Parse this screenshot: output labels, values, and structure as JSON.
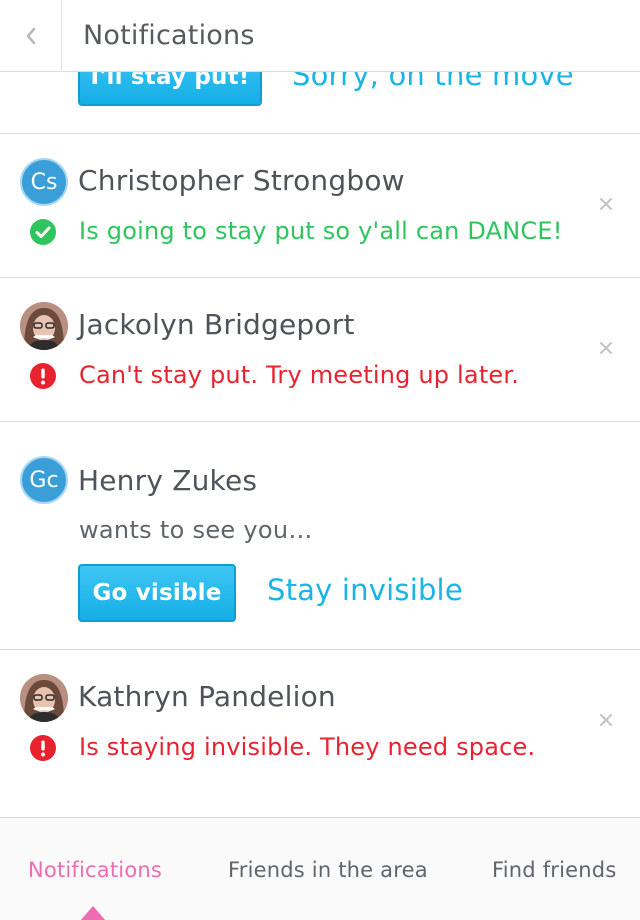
{
  "header": {
    "title": "Notifications",
    "back_icon": "chevron-left-icon"
  },
  "notifications": [
    {
      "primary_button": "I'll stay put!",
      "secondary_link": "Sorry, on the move"
    },
    {
      "avatar_initials": "Cs",
      "name": "Christopher Strongbow",
      "status_type": "success",
      "status_icon": "check-circle-icon",
      "status_text": "Is going to stay put so y'all can DANCE!"
    },
    {
      "avatar_type": "photo",
      "name": "Jackolyn Bridgeport",
      "status_type": "error",
      "status_icon": "exclamation-circle-icon",
      "status_text": "Can't stay put. Try meeting up later."
    },
    {
      "avatar_initials": "Gc",
      "name": "Henry Zukes",
      "message": "wants to see you…",
      "primary_button": "Go visible",
      "secondary_link": "Stay invisible"
    },
    {
      "avatar_type": "photo",
      "name": "Kathryn Pandelion",
      "status_type": "error",
      "status_icon": "exclamation-circle-icon",
      "status_text": "Is staying invisible. They need space."
    }
  ],
  "tabbar": {
    "tabs": [
      {
        "label": "Notifications",
        "active": true
      },
      {
        "label": "Friends in the area",
        "active": false
      },
      {
        "label": "Find friends",
        "active": false
      }
    ]
  },
  "colors": {
    "accent_blue": "#1ab4e6",
    "success_green": "#2ec55e",
    "error_red": "#e8232f",
    "active_tab_pink": "#ef6bb2"
  }
}
